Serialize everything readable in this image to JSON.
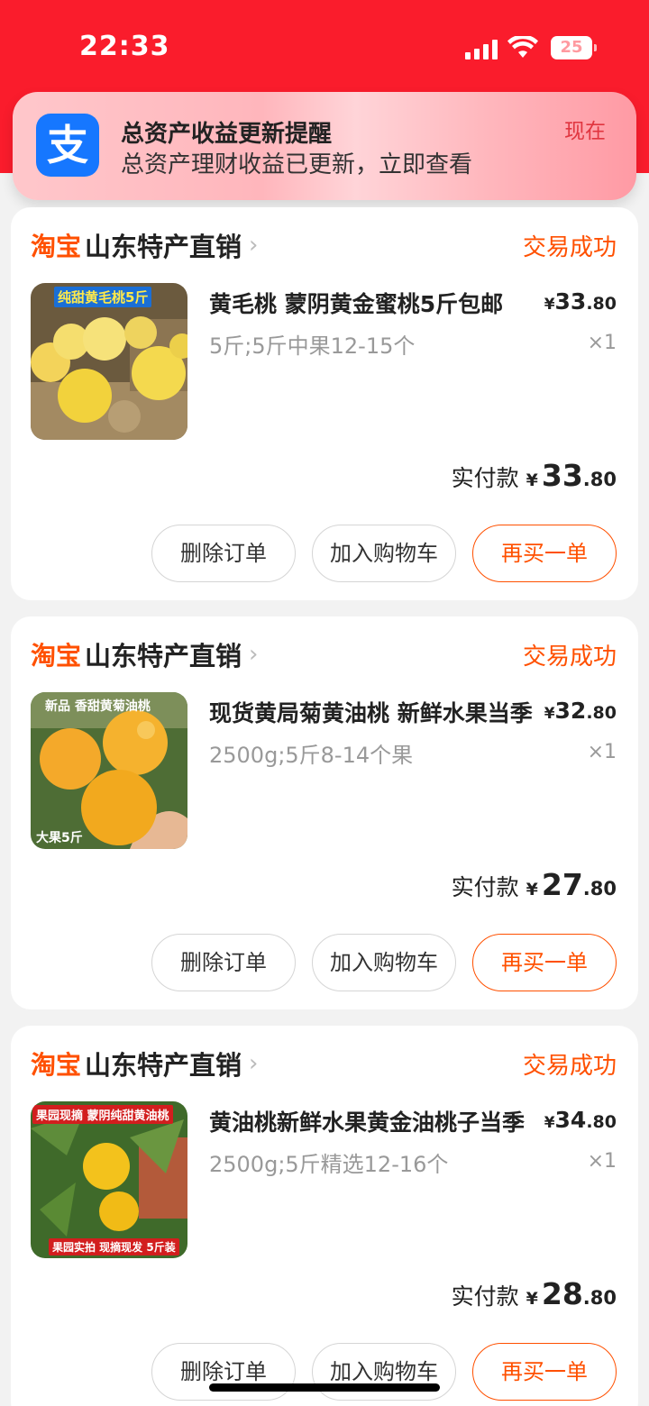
{
  "status_bar": {
    "time": "22:33",
    "battery": "25"
  },
  "notification": {
    "app_icon": "支",
    "title": "总资产收益更新提醒",
    "body": "总资产理财收益已更新，立即查看",
    "time": "现在"
  },
  "orders": [
    {
      "platform": "淘宝",
      "shop": "山东特产直销",
      "status": "交易成功",
      "title": "黄毛桃 蒙阴黄金蜜桃5斤包邮",
      "spec": "5斤;5斤中果12-15个",
      "unit_price": {
        "currency": "¥",
        "integer": "33",
        "decimal": ".80"
      },
      "qty": "×1",
      "paid_label": "实付款",
      "paid": {
        "currency": "¥",
        "integer": "33",
        "decimal": ".80"
      },
      "image_tags": [
        "纯甜黄毛桃5斤"
      ],
      "buttons": {
        "delete": "删除订单",
        "cart": "加入购物车",
        "rebuy": "再买一单"
      }
    },
    {
      "platform": "淘宝",
      "shop": "山东特产直销",
      "status": "交易成功",
      "title": "现货黄局菊黄油桃 新鲜水果当季",
      "spec": "2500g;5斤8-14个果",
      "unit_price": {
        "currency": "¥",
        "integer": "32",
        "decimal": ".80"
      },
      "qty": "×1",
      "paid_label": "实付款",
      "paid": {
        "currency": "¥",
        "integer": "27",
        "decimal": ".80"
      },
      "image_tags": [
        "新品 香甜黄菊油桃",
        "大果5斤"
      ],
      "buttons": {
        "delete": "删除订单",
        "cart": "加入购物车",
        "rebuy": "再买一单"
      }
    },
    {
      "platform": "淘宝",
      "shop": "山东特产直销",
      "status": "交易成功",
      "title": "黄油桃新鲜水果黄金油桃子当季",
      "spec": "2500g;5斤精选12-16个",
      "unit_price": {
        "currency": "¥",
        "integer": "34",
        "decimal": ".80"
      },
      "qty": "×1",
      "paid_label": "实付款",
      "paid": {
        "currency": "¥",
        "integer": "28",
        "decimal": ".80"
      },
      "image_tags": [
        "果园现摘 蒙阴纯甜黄油桃",
        "果园实拍 现摘现发 5斤装"
      ],
      "buttons": {
        "delete": "删除订单",
        "cart": "加入购物车",
        "rebuy": "再买一单"
      }
    }
  ],
  "colors": {
    "brand_red": "#fa1c2c",
    "taobao_orange": "#ff5000",
    "alipay_blue": "#1677ff"
  }
}
